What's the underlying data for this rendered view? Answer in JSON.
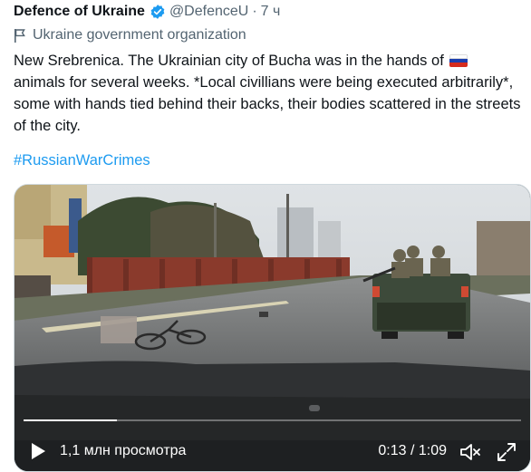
{
  "tweet": {
    "author_name": "Defence of Ukraine",
    "handle": "@DefenceU",
    "separator": "·",
    "time": "7 ч",
    "affiliation": "Ukraine government organization",
    "text_line_1a": "New Srebrenica. The Ukrainian city of Bucha was in the hands of",
    "text_rest": "animals for several weeks. *Local civillians were being executed arbitrarily*, some with hands tied behind their backs, their bodies scattered in the streets of the city.",
    "hashtag": "#RussianWarCrimes"
  },
  "video": {
    "views": "1,1 млн просмотра",
    "current_time": "0:13",
    "time_separator": " / ",
    "duration": "1:09",
    "progress_fraction": 0.188
  },
  "colors": {
    "accent": "#1d9bf0",
    "secondary_text": "#536471",
    "primary_text": "#0f1419"
  },
  "icons": {
    "badge": "verified-badge-icon",
    "affiliation": "flag-icon",
    "emoji": "russia-flag-icon",
    "play": "play-icon",
    "volume": "volume-icon",
    "fullscreen": "fullscreen-icon"
  }
}
